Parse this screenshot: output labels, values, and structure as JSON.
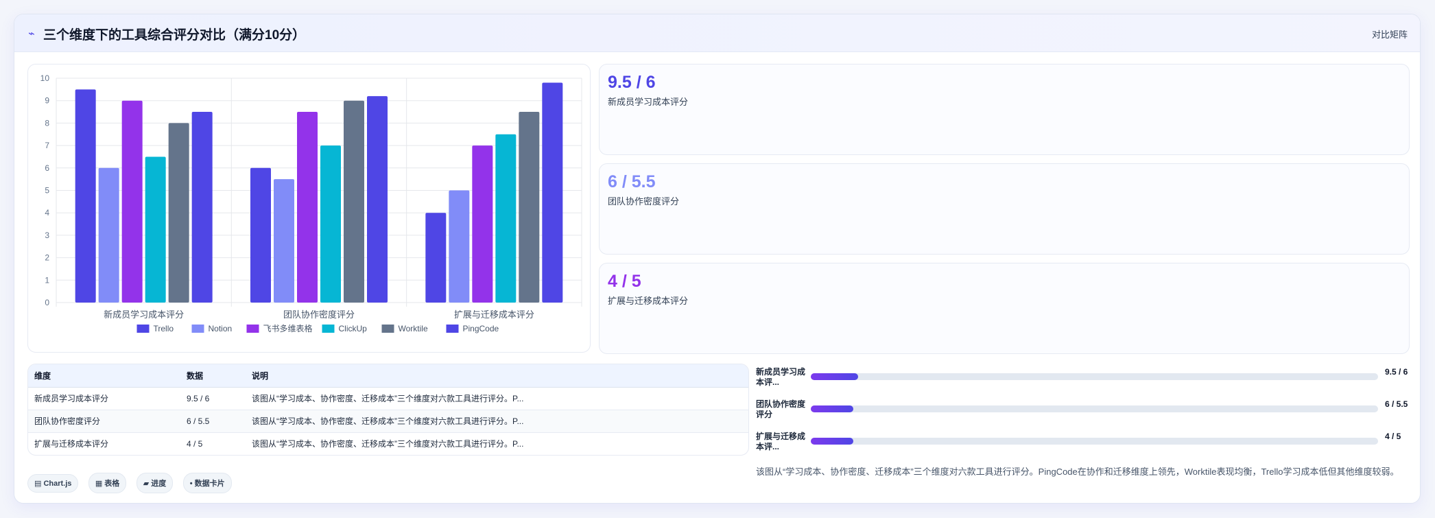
{
  "header": {
    "icon": "⌁",
    "title": "三个维度下的工具综合评分对比（满分10分）",
    "right_label": "对比矩阵"
  },
  "chart_data": {
    "type": "bar",
    "categories": [
      "新成员学习成本评分",
      "团队协作密度评分",
      "扩展与迁移成本评分"
    ],
    "series": [
      {
        "name": "Trello",
        "color": "#4f46e5",
        "values": [
          9.5,
          6,
          4
        ]
      },
      {
        "name": "Notion",
        "color": "#818cf8",
        "values": [
          6,
          5.5,
          5
        ]
      },
      {
        "name": "飞书多维表格",
        "color": "#9333ea",
        "values": [
          9,
          8.5,
          7
        ]
      },
      {
        "name": "ClickUp",
        "color": "#06b6d4",
        "values": [
          6.5,
          7,
          7.5
        ]
      },
      {
        "name": "Worktile",
        "color": "#64748b",
        "values": [
          8,
          9,
          8.5
        ]
      },
      {
        "name": "PingCode",
        "color": "#4f46e5",
        "values": [
          8.5,
          9.2,
          9.8
        ]
      }
    ],
    "ylim": [
      0,
      10
    ],
    "yticks": [
      0,
      1,
      2,
      3,
      4,
      5,
      6,
      7,
      8,
      9,
      10
    ],
    "grid": true,
    "legend": "bottom",
    "xlabel": "",
    "ylabel": ""
  },
  "stats": [
    {
      "value": "9.5 / 6",
      "label": "新成员学习成本评分",
      "color": "#4f46e5"
    },
    {
      "value": "6 / 5.5",
      "label": "团队协作密度评分",
      "color": "#818cf8"
    },
    {
      "value": "4 / 5",
      "label": "扩展与迁移成本评分",
      "color": "#9333ea"
    }
  ],
  "table": {
    "headers": [
      "维度",
      "数据",
      "说明"
    ],
    "rows": [
      [
        "新成员学习成本评分",
        "9.5 / 6",
        "该图从“学习成本、协作密度、迁移成本”三个维度对六款工具进行评分。P..."
      ],
      [
        "团队协作密度评分",
        "6 / 5.5",
        "该图从“学习成本、协作密度、迁移成本”三个维度对六款工具进行评分。P..."
      ],
      [
        "扩展与迁移成本评分",
        "4 / 5",
        "该图从“学习成本、协作密度、迁移成本”三个维度对六款工具进行评分。P..."
      ]
    ]
  },
  "progress": [
    {
      "label": "新成员学习成本评...",
      "value": "9.5 / 6",
      "fraction": 0.083
    },
    {
      "label": "团队协作密度评分",
      "value": "6 / 5.5",
      "fraction": 0.075
    },
    {
      "label": "扩展与迁移成本评...",
      "value": "4 / 5",
      "fraction": 0.075
    }
  ],
  "summary": "该图从“学习成本、协作密度、迁移成本”三个维度对六款工具进行评分。PingCode在协作和迁移维度上领先，Worktile表现均衡，Trello学习成本低但其他维度较弱。",
  "chips": [
    "▤ Chart.js",
    "▦ 表格",
    "▰ 进度",
    "• 数据卡片"
  ]
}
